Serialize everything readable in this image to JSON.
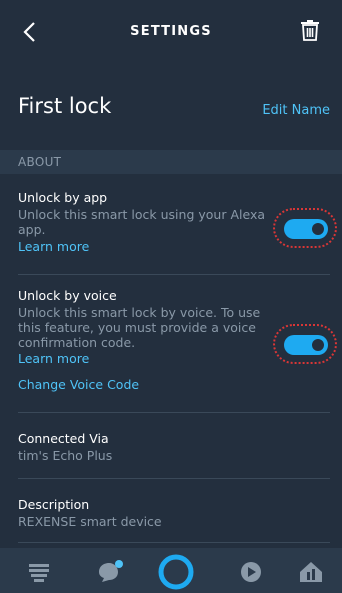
{
  "header": {
    "title": "SETTINGS",
    "back_icon": "chevron-left-icon",
    "trash_icon": "trash-icon"
  },
  "device": {
    "name": "First lock",
    "edit_label": "Edit Name"
  },
  "section": {
    "label": "ABOUT"
  },
  "unlock_app": {
    "title": "Unlock by app",
    "description": "Unlock this smart lock using your Alexa app.",
    "learn_more": "Learn more",
    "enabled": true
  },
  "unlock_voice": {
    "title": "Unlock by voice",
    "description": "Unlock this smart lock by voice. To use this feature, you must provide a voice confirmation code.",
    "learn_more": "Learn more",
    "change_code": "Change Voice Code",
    "enabled": true
  },
  "connected": {
    "title": "Connected Via",
    "value": "tim's Echo Plus"
  },
  "description": {
    "title": "Description",
    "value": "REXENSE smart device"
  },
  "nav": {
    "items": [
      "home-icon",
      "chat-icon",
      "alexa-icon",
      "play-icon",
      "smart-home-icon"
    ]
  },
  "colors": {
    "background": "#232f3e",
    "accent": "#4fc3f7",
    "toggle_on": "#1eaaf1",
    "highlight": "#d93636"
  }
}
